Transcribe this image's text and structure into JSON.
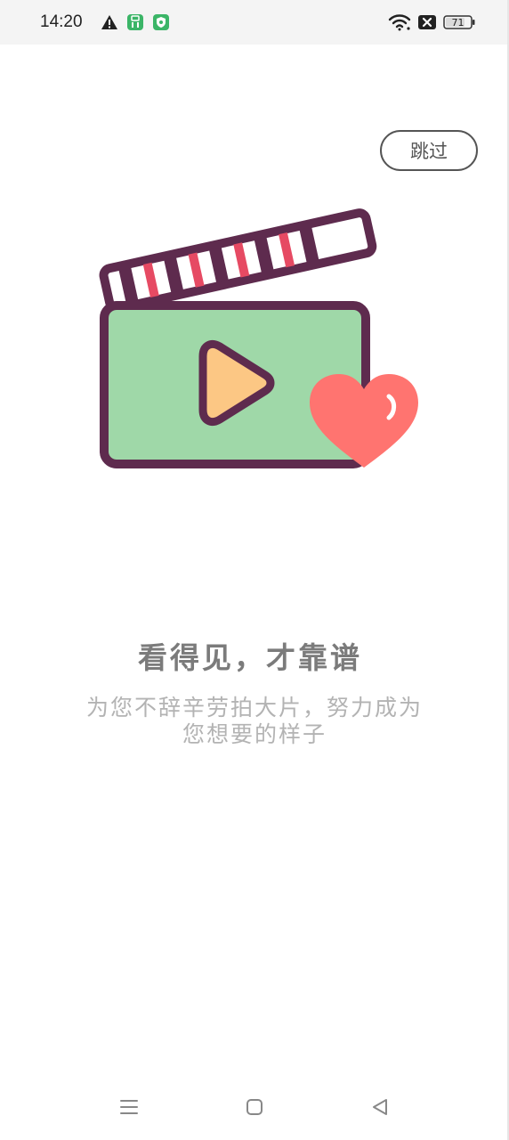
{
  "status_bar": {
    "time": "14:20",
    "battery": "71",
    "icons": [
      "warning-icon",
      "sim-card-icon",
      "shield-icon",
      "wifi-icon",
      "no-signal-icon",
      "battery-icon"
    ]
  },
  "skip_label": "跳过",
  "illustration": {
    "icon": "video-clapperboard-heart-illustration",
    "colors": {
      "outline": "#5e2b4e",
      "screen": "#9fd8a8",
      "play": "#fcc784",
      "heart": "#ff7470",
      "stripe": "#e64a63"
    }
  },
  "headline": "看得见，才靠谱",
  "subtitle": {
    "line1": "为您不辞辛劳拍大片，努力成为",
    "line2": "您想要的样子"
  },
  "nav": {
    "icons": [
      "menu-icon",
      "home-icon",
      "back-icon"
    ]
  }
}
